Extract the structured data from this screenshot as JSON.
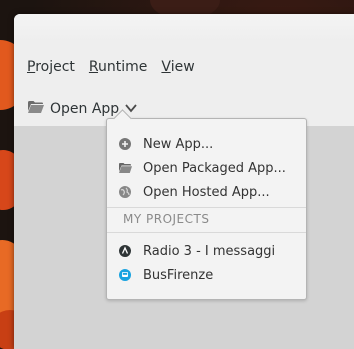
{
  "menubar": {
    "project": {
      "mnemonic": "P",
      "rest": "roject"
    },
    "runtime": {
      "mnemonic": "R",
      "rest": "untime"
    },
    "view": {
      "mnemonic": "V",
      "rest": "iew"
    }
  },
  "toolbar": {
    "open_app_label": "Open App",
    "folder_icon": "folder-icon",
    "dropdown_icon": "chevron-down-icon"
  },
  "popup": {
    "items": [
      {
        "label": "New App...",
        "icon": "plus-circle-icon"
      },
      {
        "label": "Open Packaged App...",
        "icon": "folder-icon"
      },
      {
        "label": "Open Hosted App...",
        "icon": "globe-icon"
      }
    ],
    "section_header": "MY PROJECTS",
    "projects": [
      {
        "label": "Radio 3 - I messaggi",
        "icon": "app-icon-dark",
        "color": "#2e3436"
      },
      {
        "label": "BusFirenze",
        "icon": "bus-icon",
        "color": "#1aa3e0"
      }
    ]
  }
}
